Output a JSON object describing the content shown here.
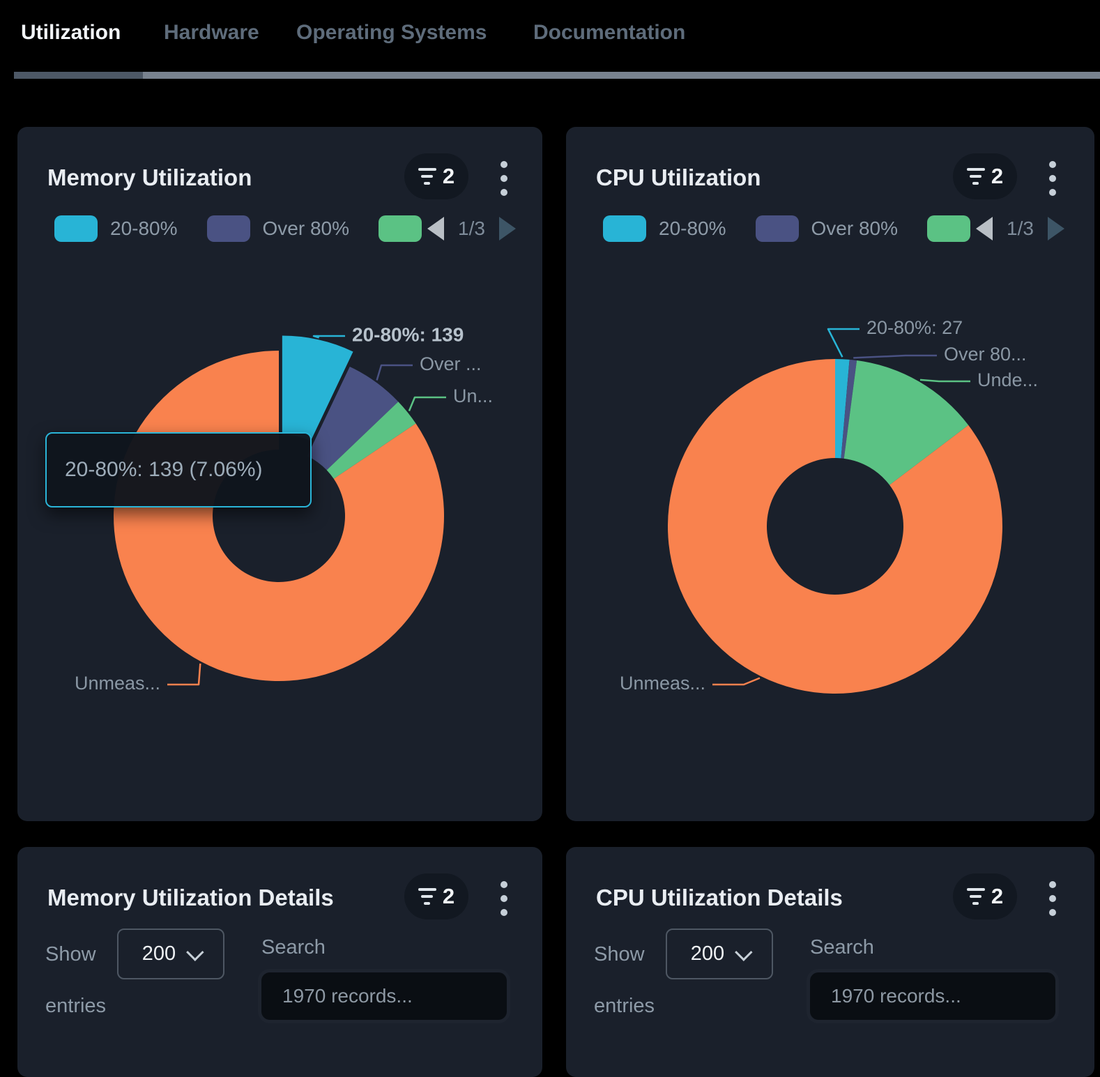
{
  "tabs": {
    "items": [
      {
        "label": "Utilization",
        "active": true
      },
      {
        "label": "Hardware",
        "active": false
      },
      {
        "label": "Operating Systems",
        "active": false
      },
      {
        "label": "Documentation",
        "active": false
      }
    ]
  },
  "colors": {
    "cyan": "#28b4d6",
    "indigo": "#4a5283",
    "green": "#5bc284",
    "orange": "#f9824e",
    "tooltip_border": "#2ab5d8"
  },
  "legend": {
    "items": [
      {
        "label": "20-80%",
        "color": "#28b4d6"
      },
      {
        "label": "Over 80%",
        "color": "#4a5283"
      },
      {
        "label": "",
        "color": "#5bc284"
      }
    ],
    "page": "1/3"
  },
  "memory_card": {
    "title": "Memory Utilization",
    "filter_count": "2",
    "tooltip": "20-80%: 139 (7.06%)"
  },
  "cpu_card": {
    "title": "CPU Utilization",
    "filter_count": "2"
  },
  "memory_details": {
    "title": "Memory Utilization Details",
    "filter_count": "2",
    "show": "Show",
    "entries": "entries",
    "page_size": "200",
    "search": "Search",
    "search_placeholder": "1970 records..."
  },
  "cpu_details": {
    "title": "CPU Utilization Details",
    "filter_count": "2",
    "show": "Show",
    "entries": "entries",
    "page_size": "200",
    "search": "Search",
    "search_placeholder": "1970 records..."
  },
  "chart_data": [
    {
      "type": "pie",
      "title": "Memory Utilization",
      "legend_entries": [
        "20-80%",
        "Over 80%"
      ],
      "legend_pagination": "1/3",
      "hover_tooltip": "20-80%: 139 (7.06%)",
      "slices": [
        {
          "display_label": "20-80%: 139",
          "value": 139,
          "pct": 7.06,
          "color": "#28b4d6",
          "hovered": true
        },
        {
          "display_label": "Over ...",
          "pct": 5.8,
          "color": "#4a5283",
          "hovered": false
        },
        {
          "display_label": "Un...",
          "pct": 2.7,
          "color": "#5bc284",
          "hovered": false
        },
        {
          "display_label": "Unmeas...",
          "pct": 84.44,
          "color": "#f9824e",
          "hovered": false
        }
      ]
    },
    {
      "type": "pie",
      "title": "CPU Utilization",
      "legend_entries": [
        "20-80%",
        "Over 80%"
      ],
      "legend_pagination": "1/3",
      "slices": [
        {
          "display_label": "20-80%: 27",
          "value": 27,
          "pct": 1.37,
          "color": "#28b4d6",
          "hovered": false
        },
        {
          "display_label": "Over 80...",
          "pct": 0.7,
          "color": "#4a5283",
          "hovered": false
        },
        {
          "display_label": "Unde...",
          "pct": 12.6,
          "color": "#5bc284",
          "hovered": false
        },
        {
          "display_label": "Unmeas...",
          "pct": 85.33,
          "color": "#f9824e",
          "hovered": false
        }
      ]
    }
  ]
}
